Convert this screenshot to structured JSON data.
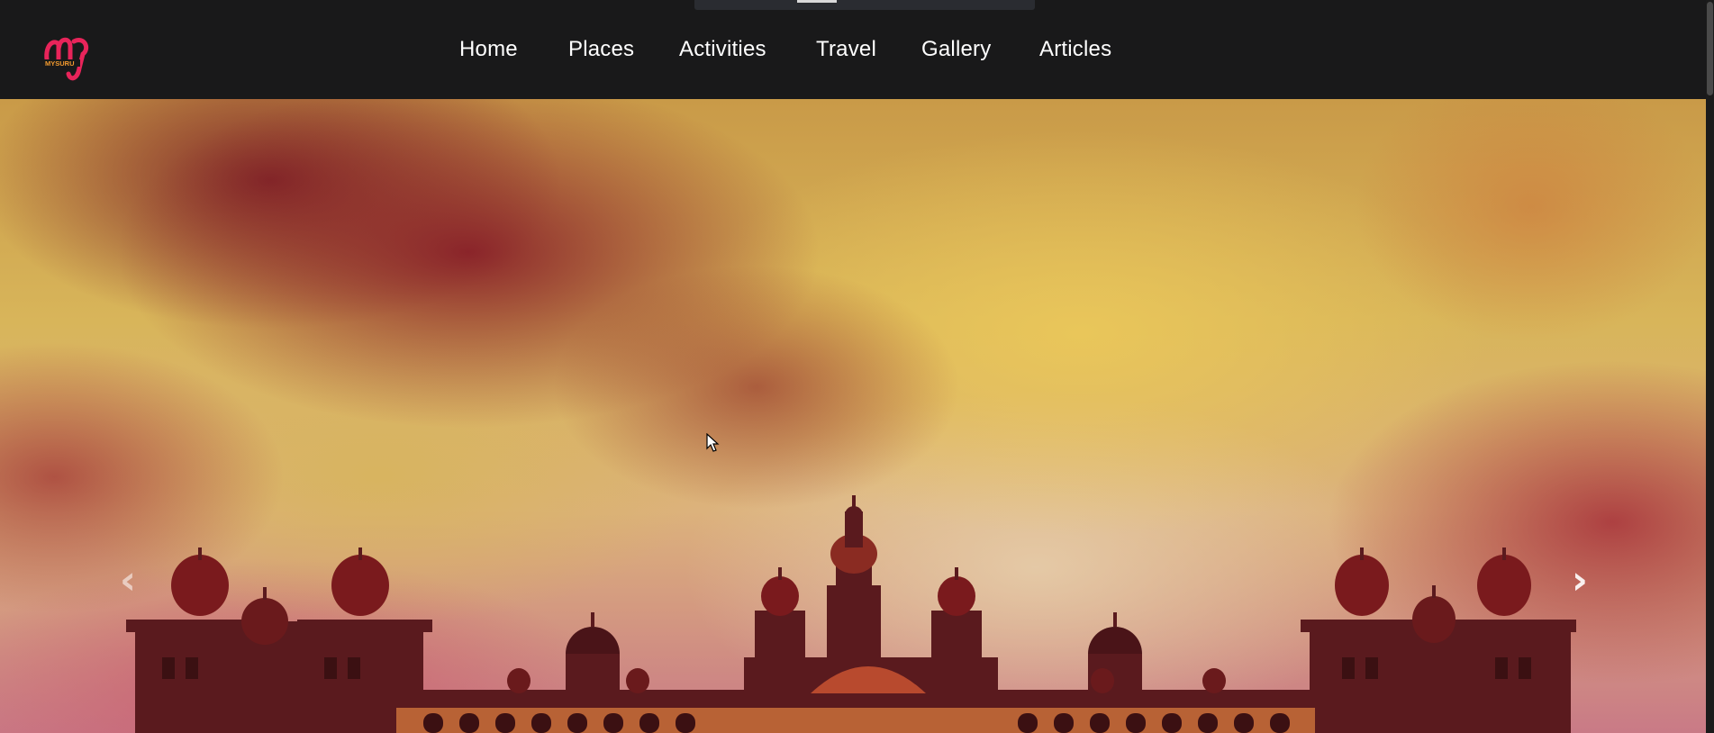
{
  "brand": {
    "logo_text": "MYSURU",
    "logo_colors": {
      "primary": "#e8245a",
      "secondary": "#f29a2e"
    }
  },
  "nav": {
    "items": [
      {
        "label": "Home"
      },
      {
        "label": "Places"
      },
      {
        "label": "Activities"
      },
      {
        "label": "Travel"
      },
      {
        "label": "Gallery"
      },
      {
        "label": "Articles"
      }
    ]
  },
  "hero": {
    "image_description": "Mysore Palace silhouette under dramatic red and yellow clouds",
    "prev_icon": "chevron-left-icon",
    "next_icon": "chevron-right-icon"
  },
  "colors": {
    "navbar_bg": "#19191a",
    "nav_text": "#ffffff"
  }
}
